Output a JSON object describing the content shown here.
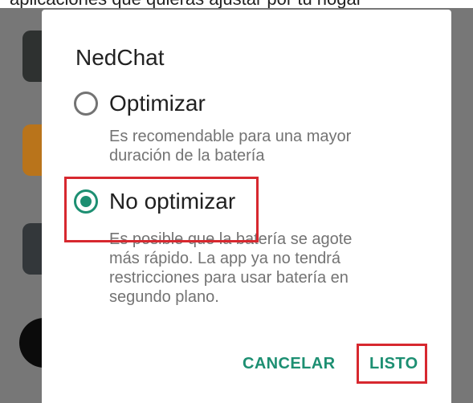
{
  "dialog": {
    "title": "NedChat",
    "options": [
      {
        "label": "Optimizar",
        "description": "Es recomendable para una mayor\nduración de la batería",
        "selected": false
      },
      {
        "label": "No optimizar",
        "description": "Es posible que la batería se agote\nmás rápido. La app ya no tendrá\nrestricciones para usar batería en\nsegundo plano.",
        "selected": true
      }
    ],
    "buttons": {
      "cancel": "CANCELAR",
      "ok": "LISTO"
    }
  },
  "colors": {
    "accent": "#1d8f72",
    "highlight_red": "#d7282f",
    "scrim": "#777777",
    "description_text": "#737373"
  },
  "background": {
    "top_text": "aplicaciones que quieras ajustar por tu hogar"
  }
}
